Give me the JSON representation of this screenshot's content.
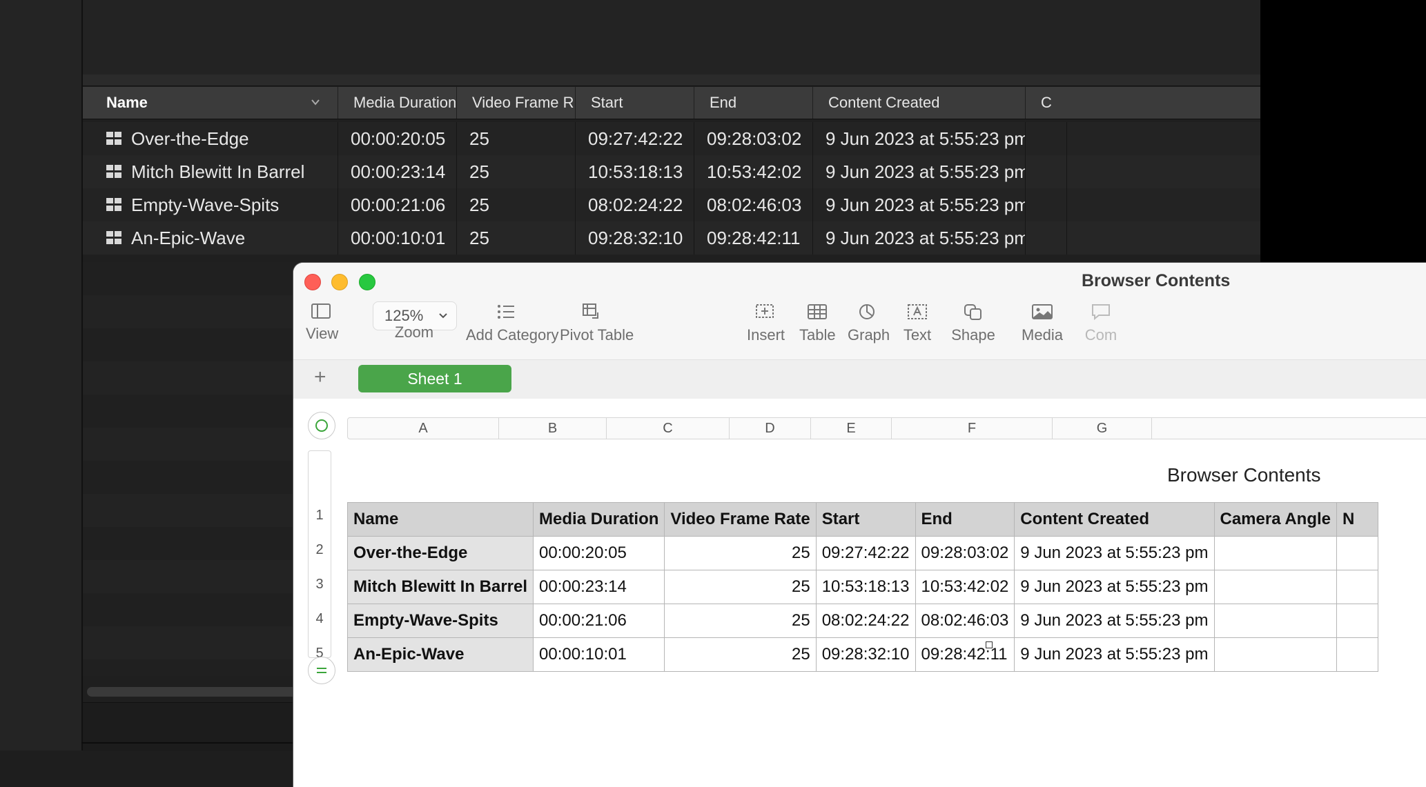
{
  "browser": {
    "columns": [
      "Name",
      "Media Duration",
      "Video Frame R...",
      "Start",
      "End",
      "Content Created",
      "C"
    ],
    "rows": [
      {
        "name": "Over-the-Edge",
        "duration": "00:00:20:05",
        "fps": "25",
        "start": "09:27:42:22",
        "end": "09:28:03:02",
        "created": "9 Jun 2023 at 5:55:23 pm"
      },
      {
        "name": "Mitch Blewitt In Barrel",
        "duration": "00:00:23:14",
        "fps": "25",
        "start": "10:53:18:13",
        "end": "10:53:42:02",
        "created": "9 Jun 2023 at 5:55:23 pm"
      },
      {
        "name": "Empty-Wave-Spits",
        "duration": "00:00:21:06",
        "fps": "25",
        "start": "08:02:24:22",
        "end": "08:02:46:03",
        "created": "9 Jun 2023 at 5:55:23 pm"
      },
      {
        "name": "An-Epic-Wave",
        "duration": "00:00:10:01",
        "fps": "25",
        "start": "09:28:32:10",
        "end": "09:28:42:11",
        "created": "9 Jun 2023 at 5:55:23 pm"
      }
    ]
  },
  "numbers": {
    "window_title": "Browser Contents",
    "toolbar": {
      "view": "View",
      "zoom_value": "125%",
      "zoom": "Zoom",
      "add_category": "Add Category",
      "pivot_table": "Pivot Table",
      "insert": "Insert",
      "table": "Table",
      "graph": "Graph",
      "text": "Text",
      "shape": "Shape",
      "media": "Media",
      "comment": "Com"
    },
    "add_sheet": "+",
    "sheet_tab": "Sheet 1",
    "column_letters": [
      "A",
      "B",
      "C",
      "D",
      "E",
      "F",
      "G"
    ],
    "row_numbers": [
      "1",
      "2",
      "3",
      "4",
      "5"
    ],
    "table_title": "Browser Contents",
    "header": [
      "Name",
      "Media Duration",
      "Video Frame Rate",
      "Start",
      "End",
      "Content Created",
      "Camera Angle",
      "N"
    ],
    "rows": [
      [
        "Over-the-Edge",
        "00:00:20:05",
        "25",
        "09:27:42:22",
        "09:28:03:02",
        "9 Jun 2023 at 5:55:23 pm",
        "",
        ""
      ],
      [
        "Mitch Blewitt In Barrel",
        "00:00:23:14",
        "25",
        "10:53:18:13",
        "10:53:42:02",
        "9 Jun 2023 at 5:55:23 pm",
        "",
        ""
      ],
      [
        "Empty-Wave-Spits",
        "00:00:21:06",
        "25",
        "08:02:24:22",
        "08:02:46:03",
        "9 Jun 2023 at 5:55:23 pm",
        "",
        ""
      ],
      [
        "An-Epic-Wave",
        "00:00:10:01",
        "25",
        "09:28:32:10",
        "09:28:42:11",
        "9 Jun 2023 at 5:55:23 pm",
        "",
        ""
      ]
    ]
  },
  "colors": {
    "sheet_tab": "#4aa54a",
    "close": "#fe5f57",
    "minimize": "#febc2e",
    "zoom": "#28c840"
  }
}
